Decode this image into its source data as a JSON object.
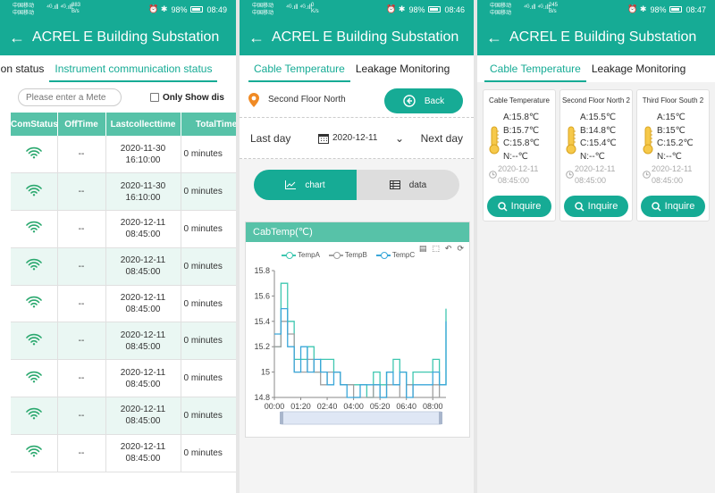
{
  "status": [
    {
      "carrier1": "中国移动",
      "carrier2": "中国移动",
      "rate": "883",
      "rate_unit": "B/s",
      "battery": "98%",
      "time": "08:49"
    },
    {
      "carrier1": "中国移动",
      "carrier2": "中国移动",
      "rate": "0",
      "rate_unit": "K/s",
      "battery": "98%",
      "time": "08:46"
    },
    {
      "carrier1": "中国移动",
      "carrier2": "中国移动",
      "rate": "245",
      "rate_unit": "B/s",
      "battery": "98%",
      "time": "08:47"
    }
  ],
  "app_title": "ACREL E Building Substation",
  "panel1": {
    "tabs": [
      "ition status",
      "Instrument communication status"
    ],
    "search_placeholder": "Please enter a Mete",
    "only_show": "Only Show dis",
    "columns": [
      "ComStatus",
      "OffTime",
      "Lastcollecttime",
      "TotalTime"
    ],
    "rows": [
      {
        "off": "--",
        "date": "2020-11-30",
        "time": "16:10:00",
        "total": "0 minutes"
      },
      {
        "off": "--",
        "date": "2020-11-30",
        "time": "16:10:00",
        "total": "0 minutes"
      },
      {
        "off": "--",
        "date": "2020-12-11",
        "time": "08:45:00",
        "total": "0 minutes"
      },
      {
        "off": "--",
        "date": "2020-12-11",
        "time": "08:45:00",
        "total": "0 minutes"
      },
      {
        "off": "--",
        "date": "2020-12-11",
        "time": "08:45:00",
        "total": "0 minutes"
      },
      {
        "off": "--",
        "date": "2020-12-11",
        "time": "08:45:00",
        "total": "0 minutes"
      },
      {
        "off": "--",
        "date": "2020-12-11",
        "time": "08:45:00",
        "total": "0 minutes"
      },
      {
        "off": "--",
        "date": "2020-12-11",
        "time": "08:45:00",
        "total": "0 minutes"
      },
      {
        "off": "--",
        "date": "2020-12-11",
        "time": "08:45:00",
        "total": "0 minutes"
      }
    ]
  },
  "panel2": {
    "tabs": [
      "Cable Temperature",
      "Leakage Monitoring"
    ],
    "location": "Second Floor North",
    "back_label": "Back",
    "last_day": "Last day",
    "date": "2020-12-11",
    "next_day": "Next day",
    "seg_chart": "chart",
    "seg_data": "data",
    "chart_title": "CabTemp(℃)"
  },
  "panel3": {
    "tabs": [
      "Cable Temperature",
      "Leakage Monitoring"
    ],
    "inquire_label": "Inquire",
    "cards": [
      {
        "name": "Cable Temperature",
        "a": "A:15.8℃",
        "b": "B:15.7℃",
        "c": "C:15.8℃",
        "n": "N:--℃",
        "date": "2020-12-11",
        "time": "08:45:00"
      },
      {
        "name": "Second Floor North 2",
        "a": "A:15.5℃",
        "b": "B:14.8℃",
        "c": "C:15.4℃",
        "n": "N:--℃",
        "date": "2020-12-11",
        "time": "08:45:00"
      },
      {
        "name": "Third Floor South 2",
        "a": "A:15℃",
        "b": "B:15℃",
        "c": "C:15.2℃",
        "n": "N:--℃",
        "date": "2020-12-11",
        "time": "08:45:00"
      }
    ]
  },
  "colors": {
    "accent": "#16ab95",
    "header": "#57c2a8",
    "tempA": "#3fc7b0",
    "tempB": "#a0a0a0",
    "tempC": "#3aa7d9"
  },
  "chart_data": {
    "type": "line",
    "title": "CabTemp(℃)",
    "ylim": [
      14.8,
      15.8
    ],
    "yticks": [
      "14.8",
      "15",
      "15.2",
      "15.4",
      "15.6",
      "15.8"
    ],
    "xticks": [
      "00:00",
      "01:20",
      "02:40",
      "04:00",
      "05:20",
      "06:40",
      "08:00"
    ],
    "legend": [
      "TempA",
      "TempB",
      "TempC"
    ],
    "legend_position": "top",
    "x": [
      "00:00",
      "00:20",
      "00:40",
      "01:00",
      "01:20",
      "01:40",
      "02:00",
      "02:20",
      "02:40",
      "03:00",
      "03:20",
      "03:40",
      "04:00",
      "04:20",
      "04:40",
      "05:00",
      "05:20",
      "05:40",
      "06:00",
      "06:20",
      "06:40",
      "07:00",
      "07:20",
      "07:40",
      "08:00",
      "08:20",
      "08:40"
    ],
    "series": [
      {
        "name": "TempA",
        "values": [
          15.2,
          15.7,
          15.4,
          15.1,
          15.1,
          15.2,
          15.0,
          15.1,
          15.1,
          15.0,
          14.9,
          14.9,
          14.9,
          14.9,
          14.8,
          15.0,
          14.9,
          15.0,
          15.1,
          15.0,
          14.9,
          15.0,
          15.0,
          15.0,
          15.1,
          14.9,
          15.5
        ]
      },
      {
        "name": "TempB",
        "values": [
          15.2,
          15.4,
          15.3,
          15.0,
          15.0,
          15.1,
          15.0,
          14.9,
          15.0,
          15.0,
          14.9,
          14.9,
          14.8,
          14.8,
          14.8,
          14.9,
          14.8,
          14.9,
          14.9,
          14.8,
          14.9,
          14.8,
          14.8,
          14.8,
          14.9,
          14.8,
          14.8
        ]
      },
      {
        "name": "TempC",
        "values": [
          15.3,
          15.5,
          15.2,
          15.0,
          15.2,
          15.0,
          15.1,
          15.0,
          14.9,
          15.0,
          14.9,
          14.8,
          14.8,
          14.9,
          14.9,
          14.9,
          14.8,
          15.0,
          14.9,
          15.0,
          14.8,
          14.9,
          14.9,
          14.9,
          15.0,
          14.9,
          15.4
        ]
      }
    ]
  }
}
